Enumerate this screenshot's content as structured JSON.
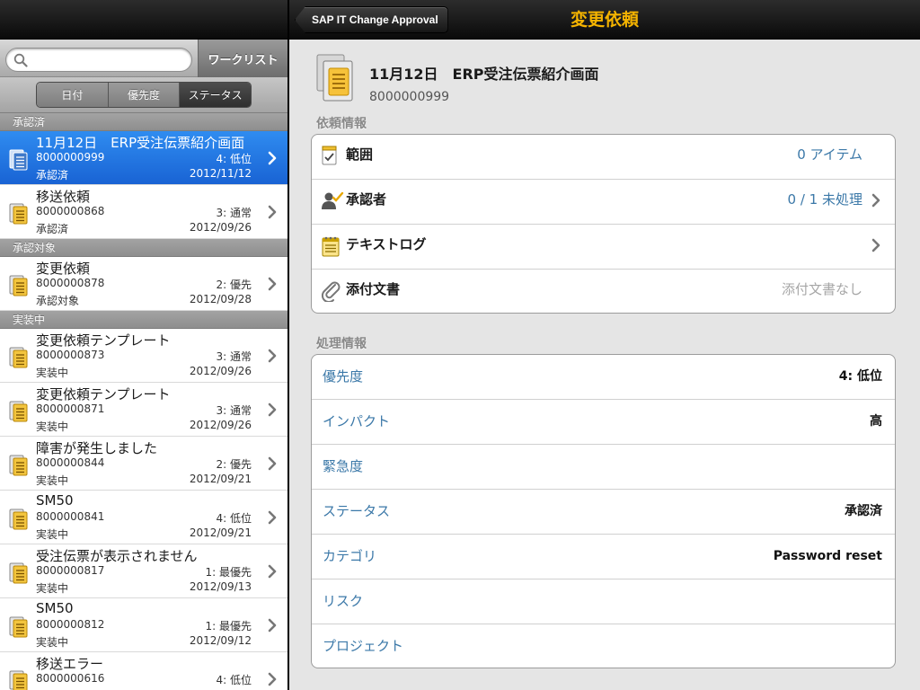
{
  "left": {
    "search": {
      "placeholder": "",
      "value": ""
    },
    "worklist_label": "ワークリスト",
    "segments": [
      {
        "label": "日付",
        "selected": false
      },
      {
        "label": "優先度",
        "selected": false
      },
      {
        "label": "ステータス",
        "selected": true
      }
    ],
    "sections": [
      {
        "header": "承認済",
        "rows": [
          {
            "title": "11月12日　ERP受注伝票紹介画面",
            "id": "8000000999",
            "priority": "4: 低位",
            "status": "承認済",
            "date": "2012/11/12",
            "selected": true
          },
          {
            "title": "移送依頼",
            "id": "8000000868",
            "priority": "3: 通常",
            "status": "承認済",
            "date": "2012/09/26",
            "selected": false
          }
        ]
      },
      {
        "header": "承認対象",
        "rows": [
          {
            "title": "変更依頼",
            "id": "8000000878",
            "priority": "2: 優先",
            "status": "承認対象",
            "date": "2012/09/28",
            "selected": false
          }
        ]
      },
      {
        "header": "実装中",
        "rows": [
          {
            "title": "変更依頼テンプレート",
            "id": "8000000873",
            "priority": "3: 通常",
            "status": "実装中",
            "date": "2012/09/26",
            "selected": false
          },
          {
            "title": "変更依頼テンプレート",
            "id": "8000000871",
            "priority": "3: 通常",
            "status": "実装中",
            "date": "2012/09/26",
            "selected": false
          },
          {
            "title": "障害が発生しました",
            "id": "8000000844",
            "priority": "2: 優先",
            "status": "実装中",
            "date": "2012/09/21",
            "selected": false
          },
          {
            "title": "SM50",
            "id": "8000000841",
            "priority": "4: 低位",
            "status": "実装中",
            "date": "2012/09/21",
            "selected": false
          },
          {
            "title": "受注伝票が表示されません",
            "id": "8000000817",
            "priority": "1: 最優先",
            "status": "実装中",
            "date": "2012/09/13",
            "selected": false
          },
          {
            "title": "SM50",
            "id": "8000000812",
            "priority": "1: 最優先",
            "status": "実装中",
            "date": "2012/09/12",
            "selected": false
          },
          {
            "title": "移送エラー",
            "id": "8000000616",
            "priority": "4: 低位",
            "status": "",
            "date": "",
            "selected": false
          }
        ]
      }
    ]
  },
  "right": {
    "back_label": "SAP IT Change Approval",
    "nav_title": "変更依頼",
    "nav_title_color": "#f5b400",
    "header": {
      "title": "11月12日　ERP受注伝票紹介画面",
      "id": "8000000999"
    },
    "request_info": {
      "label": "依頼情報",
      "rows": [
        {
          "icon": "checklist-icon",
          "label": "範囲",
          "value": "0 アイテム",
          "muted": false,
          "chevron": false
        },
        {
          "icon": "approver-icon",
          "label": "承認者",
          "value": "0 / 1 未処理",
          "muted": false,
          "chevron": true
        },
        {
          "icon": "notepad-icon",
          "label": "テキストログ",
          "value": "",
          "muted": false,
          "chevron": true
        },
        {
          "icon": "paperclip-icon",
          "label": "添付文書",
          "value": "添付文書なし",
          "muted": true,
          "chevron": false
        }
      ]
    },
    "processing_info": {
      "label": "処理情報",
      "rows": [
        {
          "label": "優先度",
          "value": "4: 低位"
        },
        {
          "label": "インパクト",
          "value": "高"
        },
        {
          "label": "緊急度",
          "value": ""
        },
        {
          "label": "ステータス",
          "value": "承認済"
        },
        {
          "label": "カテゴリ",
          "value": "Password reset"
        },
        {
          "label": "リスク",
          "value": ""
        },
        {
          "label": "プロジェクト",
          "value": ""
        }
      ]
    },
    "link_color": "#3b78a8"
  }
}
